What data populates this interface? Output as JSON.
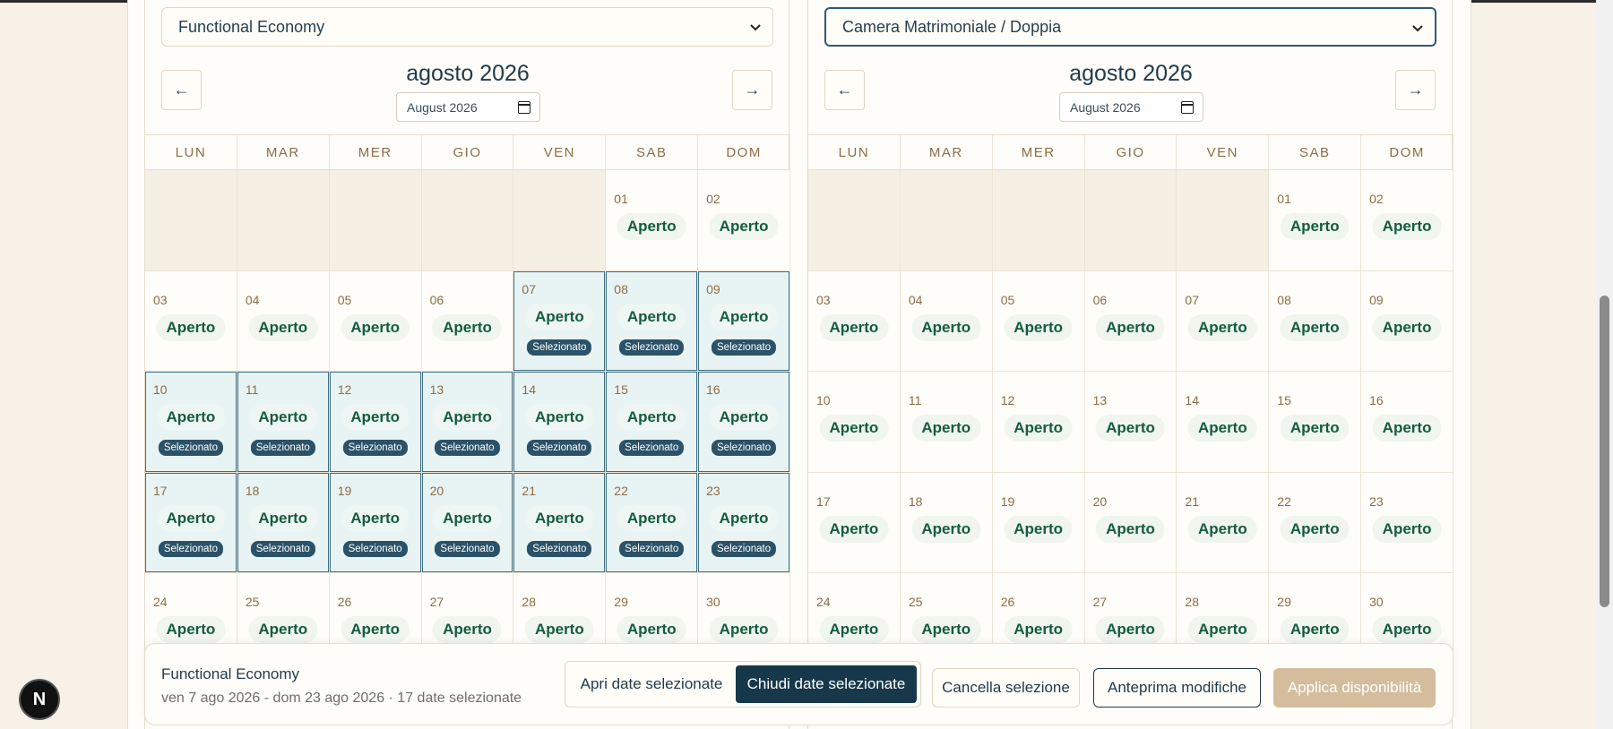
{
  "weekday_headers": [
    "LUN",
    "MAR",
    "MER",
    "GIO",
    "VEN",
    "SAB",
    "DOM"
  ],
  "status_open": "Aperto",
  "selected_badge": "Selezionato",
  "left_calendar": {
    "room_select": "Functional Economy",
    "month_title": "agosto 2026",
    "month_input": "August  2026",
    "prev_label": "←",
    "next_label": "→",
    "weeks": [
      [
        null,
        null,
        null,
        null,
        null,
        {
          "day": "01",
          "selected": false
        },
        {
          "day": "02",
          "selected": false
        }
      ],
      [
        {
          "day": "03",
          "selected": false
        },
        {
          "day": "04",
          "selected": false
        },
        {
          "day": "05",
          "selected": false
        },
        {
          "day": "06",
          "selected": false
        },
        {
          "day": "07",
          "selected": true
        },
        {
          "day": "08",
          "selected": true
        },
        {
          "day": "09",
          "selected": true
        }
      ],
      [
        {
          "day": "10",
          "selected": true
        },
        {
          "day": "11",
          "selected": true
        },
        {
          "day": "12",
          "selected": true
        },
        {
          "day": "13",
          "selected": true
        },
        {
          "day": "14",
          "selected": true
        },
        {
          "day": "15",
          "selected": true
        },
        {
          "day": "16",
          "selected": true
        }
      ],
      [
        {
          "day": "17",
          "selected": true
        },
        {
          "day": "18",
          "selected": true
        },
        {
          "day": "19",
          "selected": true
        },
        {
          "day": "20",
          "selected": true
        },
        {
          "day": "21",
          "selected": true
        },
        {
          "day": "22",
          "selected": true
        },
        {
          "day": "23",
          "selected": true
        }
      ],
      [
        {
          "day": "24",
          "selected": false
        },
        {
          "day": "25",
          "selected": false
        },
        {
          "day": "26",
          "selected": false
        },
        {
          "day": "27",
          "selected": false
        },
        {
          "day": "28",
          "selected": false
        },
        {
          "day": "29",
          "selected": false
        },
        {
          "day": "30",
          "selected": false
        }
      ]
    ]
  },
  "right_calendar": {
    "room_select": "Camera Matrimoniale / Doppia",
    "month_title": "agosto 2026",
    "month_input": "August  2026",
    "prev_label": "←",
    "next_label": "→",
    "weeks": [
      [
        null,
        null,
        null,
        null,
        null,
        {
          "day": "01",
          "selected": false
        },
        {
          "day": "02",
          "selected": false
        }
      ],
      [
        {
          "day": "03",
          "selected": false
        },
        {
          "day": "04",
          "selected": false
        },
        {
          "day": "05",
          "selected": false
        },
        {
          "day": "06",
          "selected": false
        },
        {
          "day": "07",
          "selected": false
        },
        {
          "day": "08",
          "selected": false
        },
        {
          "day": "09",
          "selected": false
        }
      ],
      [
        {
          "day": "10",
          "selected": false
        },
        {
          "day": "11",
          "selected": false
        },
        {
          "day": "12",
          "selected": false
        },
        {
          "day": "13",
          "selected": false
        },
        {
          "day": "14",
          "selected": false
        },
        {
          "day": "15",
          "selected": false
        },
        {
          "day": "16",
          "selected": false
        }
      ],
      [
        {
          "day": "17",
          "selected": false
        },
        {
          "day": "18",
          "selected": false
        },
        {
          "day": "19",
          "selected": false
        },
        {
          "day": "20",
          "selected": false
        },
        {
          "day": "21",
          "selected": false
        },
        {
          "day": "22",
          "selected": false
        },
        {
          "day": "23",
          "selected": false
        }
      ],
      [
        {
          "day": "24",
          "selected": false
        },
        {
          "day": "25",
          "selected": false
        },
        {
          "day": "26",
          "selected": false
        },
        {
          "day": "27",
          "selected": false
        },
        {
          "day": "28",
          "selected": false
        },
        {
          "day": "29",
          "selected": false
        },
        {
          "day": "30",
          "selected": false
        }
      ]
    ]
  },
  "action_bar": {
    "room_name": "Functional Economy",
    "selection_summary": "ven 7 ago 2026 - dom 23 ago 2026 · 17 date selezionate",
    "open_dates_label": "Apri date selezionate",
    "close_dates_label": "Chiudi date selezionate",
    "clear_label": "Cancella selezione",
    "preview_label": "Anteprima modifiche",
    "apply_label": "Applica disponibilità"
  },
  "logo_letter": "N",
  "icons": {
    "select_chevron": "chevron-down-icon",
    "month_picker": "calendar-icon",
    "logo": "next-logo-icon"
  }
}
